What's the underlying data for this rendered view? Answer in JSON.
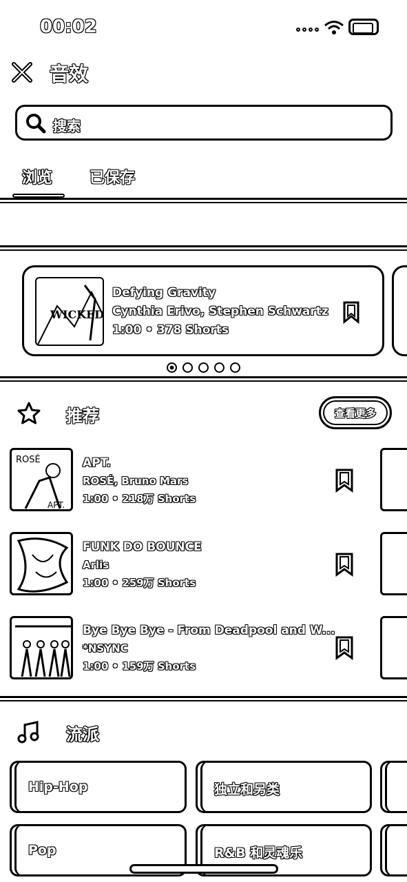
{
  "status_bar": {
    "time": "00:02"
  },
  "header": {
    "title": "音效"
  },
  "search": {
    "placeholder": "搜索"
  },
  "tabs": [
    {
      "label": "浏览"
    },
    {
      "label": "已保存"
    }
  ],
  "featured": {
    "title": "Defying Gravity",
    "artist": "Cynthia Erivo, Stephen Schwartz",
    "meta": "1:00 • 378 Shorts",
    "art_text": "WICKED",
    "pager_count": 5,
    "pager_active": 1
  },
  "recommended": {
    "title": "推荐",
    "see_more": "查看更多",
    "songs": [
      {
        "title": "APT.",
        "artist": "ROSÉ, Bruno Mars",
        "meta": "1:00 • 218万 Shorts",
        "art_text_1": "ROSÉ",
        "art_text_2": "APT."
      },
      {
        "title": "FUNK DO BOUNCE",
        "artist": "Arlis",
        "meta": "1:00 • 259万 Shorts"
      },
      {
        "title": "Bye Bye Bye - From Deadpool and W...",
        "artist": "*NSYNC",
        "meta": "1:00 • 159万 Shorts"
      }
    ]
  },
  "genres": {
    "title": "流派",
    "items": [
      {
        "label": "Hip-Hop"
      },
      {
        "label": "独立和另类"
      },
      {
        "label": "Pop"
      },
      {
        "label": "R&B 和灵魂乐"
      }
    ]
  }
}
